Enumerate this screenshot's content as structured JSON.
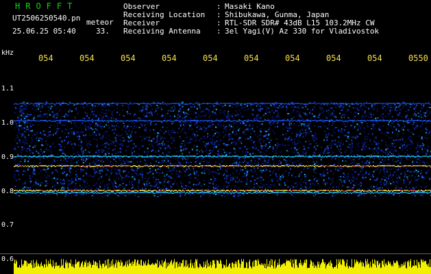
{
  "header": {
    "logo": "HROFFT",
    "file_name": "UT2506250540.pn",
    "meteor_label": "meteor",
    "date_time": "25.06.25 05:40",
    "count": "33.",
    "info": [
      {
        "key": "Observer",
        "sep": ":",
        "value": "Masaki Kano"
      },
      {
        "key": "Receiving Location",
        "sep": ":",
        "value": "Shibukawa, Gunma, Japan"
      },
      {
        "key": "Receiver",
        "sep": ":",
        "value": "RTL-SDR SDR# 43dB L15 103.2MHz CW"
      },
      {
        "key": "Receiving Antenna",
        "sep": ":",
        "value": "3el Yagi(V) Az 330 for Vladivostok"
      }
    ]
  },
  "axes": {
    "y_unit": "kHz",
    "y_ticks": [
      "1.1",
      "1.0",
      "0.9",
      "0.8",
      "0.7",
      "0.6"
    ],
    "x_ticks": [
      "054",
      "054",
      "054",
      "054",
      "054",
      "054",
      "054",
      "054",
      "054",
      "0550"
    ]
  },
  "colors": {
    "background": "#000000",
    "logo": "#14d814",
    "x_tick_text": "#f6e04a",
    "noise_dim": "#0a1a8a",
    "noise_mid": "#1f5cff",
    "noise_bright": "#22d0ff",
    "line_hot": "#ffe04a",
    "line_peak": "#ff3a3a",
    "bottom_bar": "#f2f000"
  }
}
